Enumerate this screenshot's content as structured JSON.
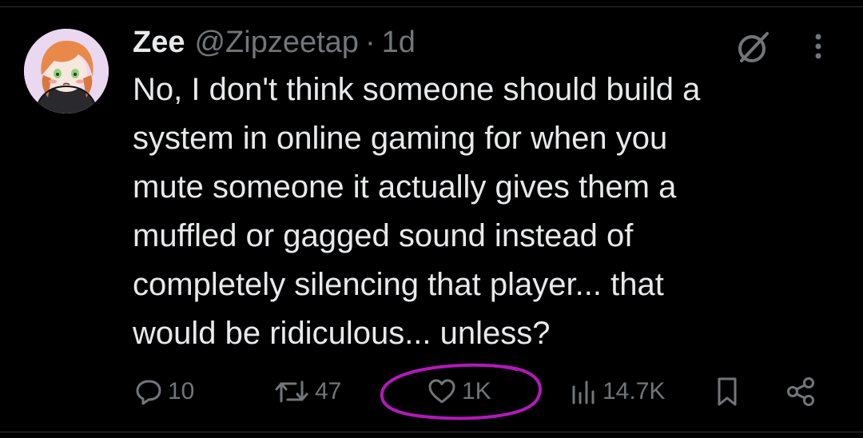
{
  "tweet": {
    "author": {
      "display_name": "Zee",
      "handle": "@Zipzeetap"
    },
    "separator": "·",
    "timestamp": "1d",
    "text": "No, I don't think someone should build a\nsystem in online gaming for when you\nmute someone it actually gives them a\nmuffled or gagged sound instead of\ncompletely silencing that player... that\nwould be ridiculous... unless?"
  },
  "actions": {
    "replies": "10",
    "reposts": "47",
    "likes": "1K",
    "views": "14.7K"
  },
  "icons": {
    "header": [
      "grok-icon",
      "more-icon"
    ],
    "actions": [
      "reply-icon",
      "repost-icon",
      "like-icon",
      "views-icon",
      "bookmark-icon",
      "share-icon"
    ]
  },
  "colors": {
    "background": "#000000",
    "text": "#e7e9ea",
    "muted": "#71767b",
    "annotation": "#b01ab8"
  }
}
